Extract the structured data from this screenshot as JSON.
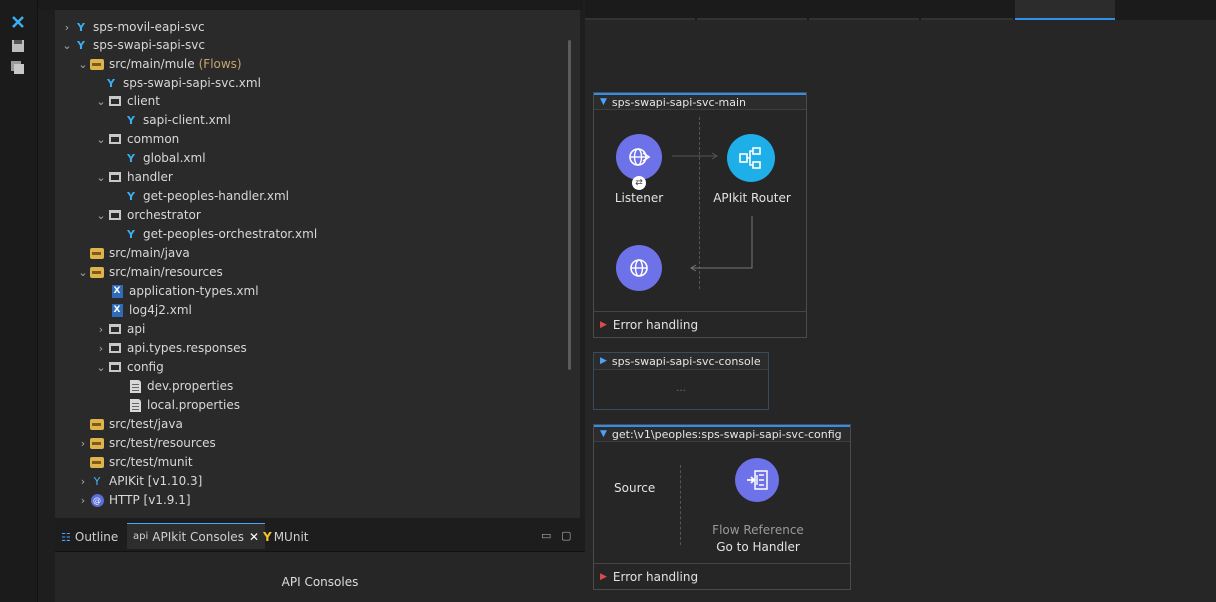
{
  "explorer": {
    "tree": [
      {
        "label": "sps-movil-eapi-svc",
        "flows": ""
      },
      {
        "label": "sps-swapi-sapi-svc",
        "flows": ""
      },
      {
        "label": "src/main/mule",
        "flows": "(Flows)"
      },
      {
        "label": "sps-swapi-sapi-svc.xml",
        "flows": ""
      },
      {
        "label": "client",
        "flows": ""
      },
      {
        "label": "sapi-client.xml",
        "flows": ""
      },
      {
        "label": "common",
        "flows": ""
      },
      {
        "label": "global.xml",
        "flows": ""
      },
      {
        "label": "handler",
        "flows": ""
      },
      {
        "label": "get-peoples-handler.xml",
        "flows": ""
      },
      {
        "label": "orchestrator",
        "flows": ""
      },
      {
        "label": "get-peoples-orchestrator.xml",
        "flows": ""
      },
      {
        "label": "src/main/java",
        "flows": ""
      },
      {
        "label": "src/main/resources",
        "flows": ""
      },
      {
        "label": "application-types.xml",
        "flows": ""
      },
      {
        "label": "log4j2.xml",
        "flows": ""
      },
      {
        "label": "api",
        "flows": ""
      },
      {
        "label": "api.types.responses",
        "flows": ""
      },
      {
        "label": "config",
        "flows": ""
      },
      {
        "label": "dev.properties",
        "flows": ""
      },
      {
        "label": "local.properties",
        "flows": ""
      },
      {
        "label": "src/test/java",
        "flows": ""
      },
      {
        "label": "src/test/resources",
        "flows": ""
      },
      {
        "label": "src/test/munit",
        "flows": ""
      },
      {
        "label": "APIKit [v1.10.3]",
        "flows": ""
      },
      {
        "label": "HTTP [v1.9.1]",
        "flows": ""
      }
    ]
  },
  "bottom_panel": {
    "tabs": {
      "outline": "Outline",
      "api_prefix": "api",
      "apikit": "APIkit Consoles",
      "munit": "MUnit"
    },
    "console_label": "API Consoles"
  },
  "canvas": {
    "flow_main": {
      "title": "sps-swapi-sapi-svc-main",
      "listener": "Listener",
      "router": "APIkit Router",
      "error": "Error handling"
    },
    "flow_console": {
      "title": "sps-swapi-sapi-svc-console",
      "collapsed": "..."
    },
    "flow_get": {
      "title": "get:\\v1\\peoples:sps-swapi-sapi-svc-config",
      "source": "Source",
      "ref_type": "Flow Reference",
      "ref_name": "Go to Handler",
      "error": "Error handling"
    }
  },
  "colors": {
    "accent": "#2f8fea",
    "mule_blue": "#3aaef0",
    "listener_purple": "#6e72e8",
    "router_blue": "#1eaee8"
  }
}
